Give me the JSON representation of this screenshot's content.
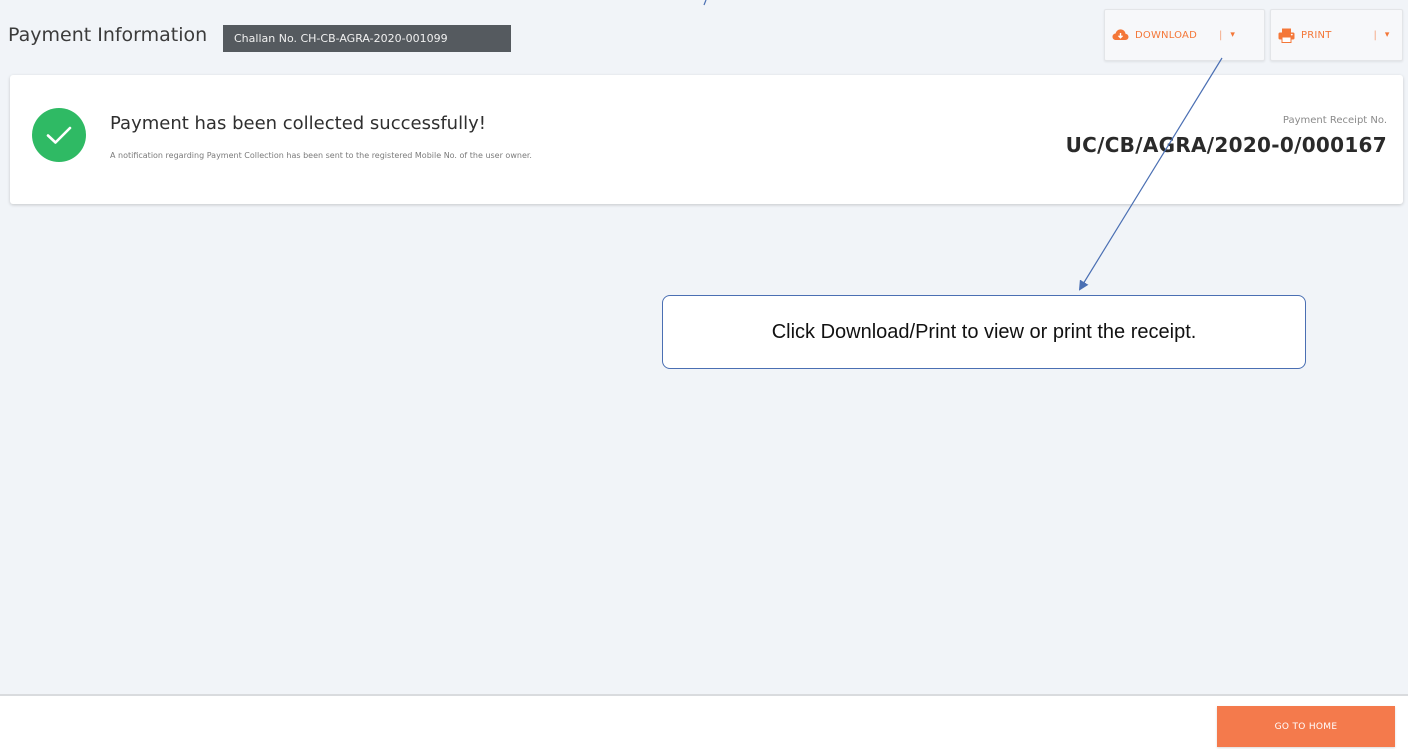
{
  "header": {
    "title": "Payment Information",
    "challan_badge": "Challan No. CH-CB-AGRA-2020-001099",
    "download": {
      "label": "DOWNLOAD",
      "separator": "|",
      "caret": "▾",
      "icon": "cloud-download-icon"
    },
    "print": {
      "label": "PRINT",
      "separator": "|",
      "caret": "▾",
      "icon": "printer-icon"
    }
  },
  "success_card": {
    "icon": "check-circle-icon",
    "title": "Payment has been collected successfully!",
    "note": "A notification regarding Payment Collection has been sent to the registered Mobile No. of the user owner.",
    "receipt_label": "Payment Receipt No.",
    "receipt_number": "UC/CB/AGRA/2020-0/000167"
  },
  "callout": {
    "text": "Click Download/Print to view or print the receipt."
  },
  "footer": {
    "go_home_label": "GO TO HOME"
  },
  "colors": {
    "accent": "#f47738",
    "success": "#2fba64",
    "badge_bg": "#555a5f",
    "callout_border": "#4a6fb3"
  }
}
